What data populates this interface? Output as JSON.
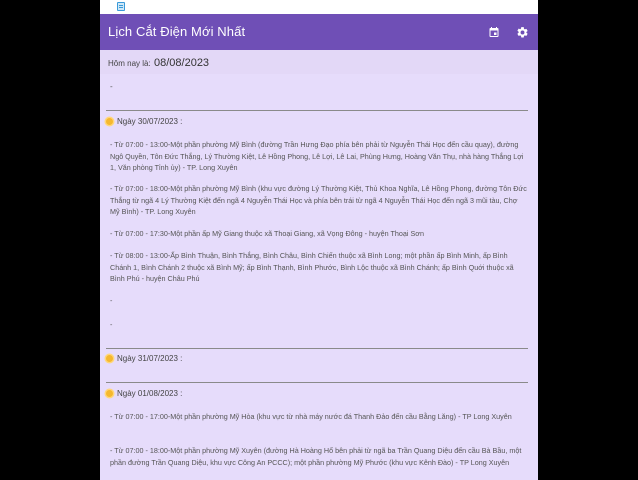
{
  "app": {
    "title": "Lịch Cắt Điện Mới Nhất"
  },
  "icons": {
    "status": "notification-icon",
    "calendar": "calendar-icon",
    "settings": "gear-icon"
  },
  "colors": {
    "appbar": "#6f4fb6",
    "background": "#e6dcfb",
    "sun": "#f5b82e"
  },
  "today": {
    "label": "Hôm nay là:",
    "value": "08/08/2023"
  },
  "feed": {
    "leading_dash": "-",
    "days": [
      {
        "header": "Ngày 30/07/2023 :",
        "entries": [
          "- Từ 07:00 - 13:00-Một phần phường Mỹ Bình (đường Trần Hưng Đạo phía bên phải từ Nguyễn Thái Học đến cầu quay), đường Ngô Quyền, Tôn Đức Thắng, Lý Thường Kiệt, Lê Hồng Phong, Lê Lợi, Lê Lai, Phùng Hưng, Hoàng Văn Thụ, nhà hàng Thắng Lợi 1, Văn phòng Tỉnh ủy) - TP. Long Xuyên",
          "- Từ 07:00 - 18:00-Một phần phường Mỹ Bình (khu vực đường Lý Thường Kiệt, Thủ Khoa Nghĩa, Lê Hồng Phong, đường Tôn Đức Thắng từ ngã 4 Lý Thường Kiệt đến ngã 4 Nguyễn Thái Học và phía bên trái từ ngã 4 Nguyễn Thái Học đến ngã 3 mũi tàu, Chợ Mỹ Bình) - TP. Long Xuyên",
          "- Từ 07:00 - 17:30-Một phần ấp Mỹ Giang thuộc xã Thoại Giang, xã Vọng Đông - huyện Thoại Sơn",
          "- Từ 08:00 - 13:00-Ấp Bình Thuận, Bình Thắng, Bình Châu, Bình Chiến thuộc xã Bình Long; một phần ấp Bình Minh, ấp Bình Chánh 1, Bình Chánh 2 thuộc xã Bình Mỹ; ấp Bình Thạnh, Bình Phước, Bình Lộc thuộc xã Bình Chánh; ấp Bình Quới thuộc xã Bình Phú - huyện Châu Phú",
          "-",
          "-"
        ]
      },
      {
        "header": "Ngày 31/07/2023 :",
        "entries": []
      },
      {
        "header": "Ngày 01/08/2023 :",
        "entries": [
          "- Từ 07:00 - 17:00-Một phần phường Mỹ Hòa (khu vực từ nhà máy nước đá Thanh Đảo đến cầu Bằng Lăng) - TP Long Xuyên",
          "- Từ 07:00 - 18:00-Một phần phường Mỹ Xuyên (đường Hà Hoàng Hổ bên phải từ ngã ba Trần Quang Diệu đến cầu Bà Bầu, một phần đường Trần Quang Diệu, khu vực Công An PCCC); một phần phường Mỹ Phước (khu vực Kênh Đào) - TP Long Xuyên"
        ]
      }
    ]
  }
}
